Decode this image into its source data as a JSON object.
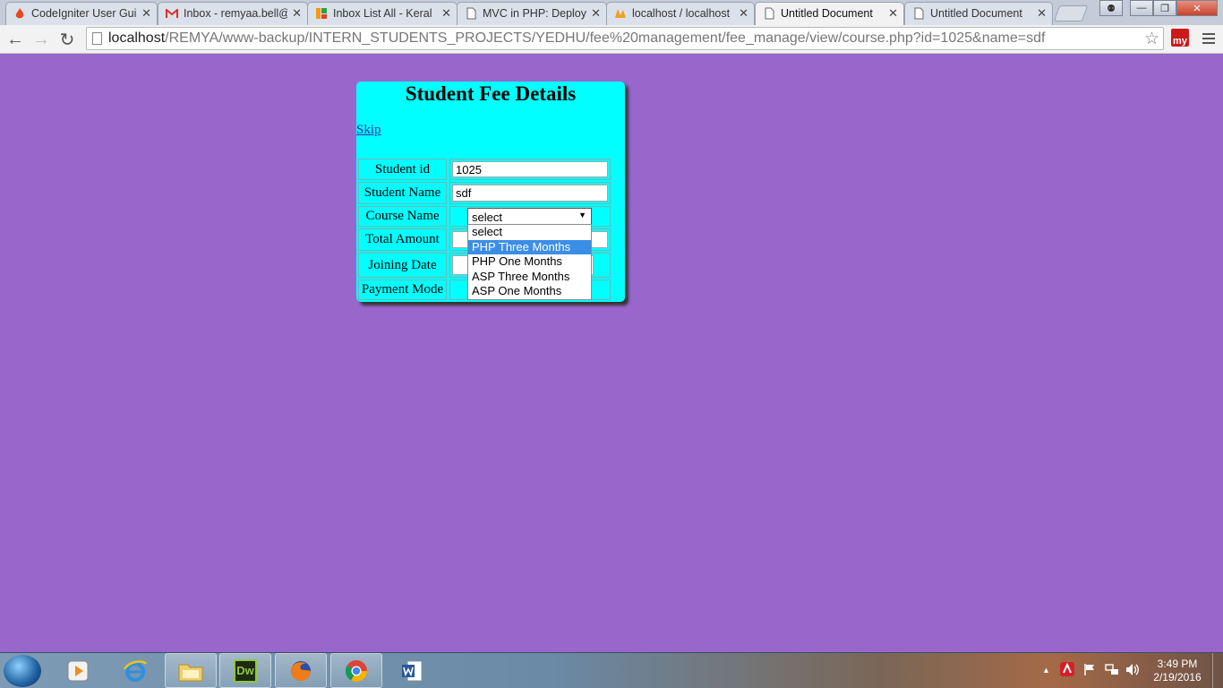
{
  "browser": {
    "tabs": [
      {
        "title": "CodeIgniter User Gui",
        "icon": "flame-icon",
        "active": false
      },
      {
        "title": "Inbox - remyaa.bell@",
        "icon": "gmail-icon",
        "active": false
      },
      {
        "title": "Inbox List All - Keral",
        "icon": "colorful-logo-icon",
        "active": false
      },
      {
        "title": "MVC in PHP: Deployi",
        "icon": "document-icon",
        "active": false
      },
      {
        "title": "localhost / localhost",
        "icon": "phpmyadmin-icon",
        "active": false
      },
      {
        "title": "Untitled Document",
        "icon": "document-icon",
        "active": true
      },
      {
        "title": "Untitled Document",
        "icon": "document-icon",
        "active": false
      }
    ],
    "url_host": "localhost",
    "url_path": "/REMYA/www-backup/INTERN_STUDENTS_PROJECTS/YEDHU/fee%20management/fee_manage/view/course.php?id=1025&name=sdf",
    "extension_label": "my"
  },
  "form": {
    "title": "Student Fee Details",
    "skip_link": "Skip",
    "labels": {
      "student_id": "Student id",
      "student_name": "Student Name",
      "course_name": "Course Name",
      "total_amount": "Total Amount",
      "joining_date": "Joining Date",
      "payment_mode": "Payment Mode"
    },
    "values": {
      "student_id": "1025",
      "student_name": "sdf",
      "course_selected": "select"
    },
    "course_options": [
      "select",
      "PHP Three Months",
      "PHP One Months",
      "ASP Three Months",
      "ASP One Months"
    ],
    "highlighted_option": "PHP Three Months"
  },
  "taskbar": {
    "apps": [
      "windows-media-player",
      "internet-explorer",
      "file-explorer",
      "dreamweaver",
      "firefox",
      "chrome",
      "word"
    ],
    "dreamweaver_label": "Dw",
    "time": "3:49 PM",
    "date": "2/19/2016"
  },
  "colors": {
    "page_background": "#9966cc",
    "card_background": "#00ffff",
    "highlight": "#3b8ee6"
  }
}
